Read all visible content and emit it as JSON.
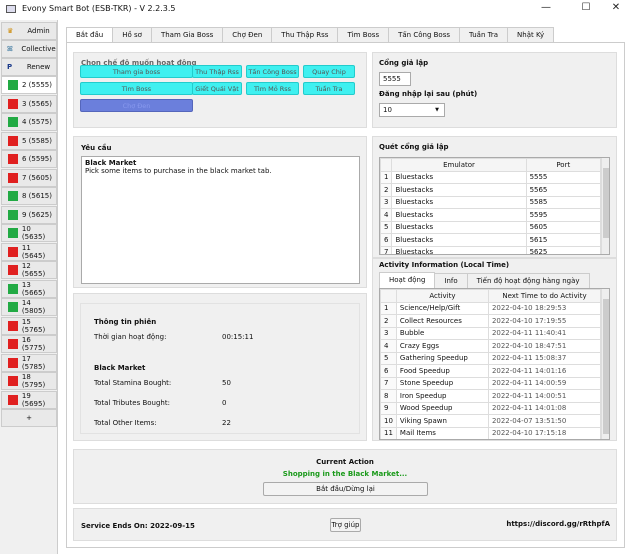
{
  "window": {
    "title": "Evony Smart Bot (ESB-TKR) - V 2.2.3.5",
    "minimize": "—",
    "maximize": "☐",
    "close": "✕"
  },
  "sidebar": {
    "top": [
      {
        "label": "Admin",
        "icon": "crown-icon"
      },
      {
        "label": "Collective",
        "icon": "people-icon"
      },
      {
        "label": "Renew",
        "icon": "paypal-icon"
      }
    ],
    "accounts": [
      {
        "label": "2 (5555)",
        "status": "#22aa44"
      },
      {
        "label": "3 (5565)",
        "status": "#e02020"
      },
      {
        "label": "4 (5575)",
        "status": "#22aa44"
      },
      {
        "label": "5 (5585)",
        "status": "#e02020"
      },
      {
        "label": "6 (5595)",
        "status": "#e02020"
      },
      {
        "label": "7 (5605)",
        "status": "#e02020"
      },
      {
        "label": "8 (5615)",
        "status": "#22aa44"
      },
      {
        "label": "9 (5625)",
        "status": "#22aa44"
      },
      {
        "label": "10 (5635)",
        "status": "#22aa44"
      },
      {
        "label": "11 (5645)",
        "status": "#e02020"
      },
      {
        "label": "12 (5655)",
        "status": "#e02020"
      },
      {
        "label": "13 (5665)",
        "status": "#22aa44"
      },
      {
        "label": "14 (5805)",
        "status": "#22aa44"
      },
      {
        "label": "15 (5765)",
        "status": "#e02020"
      },
      {
        "label": "16 (5775)",
        "status": "#e02020"
      },
      {
        "label": "17 (5785)",
        "status": "#e02020"
      },
      {
        "label": "18 (5795)",
        "status": "#e02020"
      },
      {
        "label": "19 (5695)",
        "status": "#e02020"
      }
    ],
    "add": "+"
  },
  "tabs": [
    "Bắt đầu",
    "Hồ sơ",
    "Tham Gia Boss",
    "Chợ Đen",
    "Thu Thập Rss",
    "Tìm Boss",
    "Tấn Công Boss",
    "Tuần Tra",
    "Nhật Ký"
  ],
  "mode": {
    "title": "Chọn chế độ muốn hoạt động",
    "buttons": [
      "Tham gia boss",
      "Thu Thập Rss",
      "Tấn Công Boss",
      "Quay Chip",
      "Tìm Boss",
      "Giết Quái Vật",
      "Tìm Mỏ Rss",
      "Tuần Tra",
      "Chợ Đen"
    ]
  },
  "emulator": {
    "port_label": "Cổng giả lập",
    "port": "5555",
    "relogin_label": "Đăng nhập lại sau (phút)",
    "relogin": "10"
  },
  "request": {
    "title": "Yêu cầu",
    "heading": "Black Market",
    "text": "Pick some items to purchase in the black market tab."
  },
  "scan": {
    "title": "Quét cổng giả lập",
    "headers": [
      "Emulator",
      "Port"
    ],
    "rows": [
      [
        "Bluestacks",
        "5555"
      ],
      [
        "Bluestacks",
        "5565"
      ],
      [
        "Bluestacks",
        "5585"
      ],
      [
        "Bluestacks",
        "5595"
      ],
      [
        "Bluestacks",
        "5605"
      ],
      [
        "Bluestacks",
        "5615"
      ],
      [
        "Bluestacks",
        "5625"
      ]
    ]
  },
  "stats": {
    "session_title": "Thông tin phiên",
    "uptime_label": "Thời gian hoạt động:",
    "uptime": "00:15:11",
    "bm_title": "Black Market",
    "rows": [
      {
        "label": "Total Stamina Bought:",
        "value": "50"
      },
      {
        "label": "Total Tributes Bought:",
        "value": "0"
      },
      {
        "label": "Total Other Items:",
        "value": "22"
      }
    ]
  },
  "activity": {
    "title": "Activity Information (Local Time)",
    "tabs": [
      "Hoạt động",
      "Info",
      "Tiến độ hoạt động hàng ngày"
    ],
    "headers": [
      "Activity",
      "Next Time to do Activity"
    ],
    "rows": [
      [
        "Science/Help/Gift",
        "2022-04-10 18:29:53"
      ],
      [
        "Collect Resources",
        "2022-04-10 17:19:55"
      ],
      [
        "Bubble",
        "2022-04-11 11:40:41"
      ],
      [
        "Crazy Eggs",
        "2022-04-10 18:47:51"
      ],
      [
        "Gathering Speedup",
        "2022-04-11 15:08:37"
      ],
      [
        "Food Speedup",
        "2022-04-11 14:01:16"
      ],
      [
        "Stone Speedup",
        "2022-04-11 14:00:59"
      ],
      [
        "Iron Speedup",
        "2022-04-11 14:00:51"
      ],
      [
        "Wood Speedup",
        "2022-04-11 14:01:08"
      ],
      [
        "Viking Spawn",
        "2022-04-07 13:51:50"
      ],
      [
        "Mail Items",
        "2022-04-10 17:15:18"
      ]
    ]
  },
  "current": {
    "title": "Current Action",
    "status": "Shopping in the Black Market...",
    "start_stop": "Bắt đầu/Dừng lại"
  },
  "footer": {
    "service": "Service Ends On: 2022-09-15",
    "help": "Trợ giúp",
    "discord": "https://discord.gg/rRthpfA"
  }
}
